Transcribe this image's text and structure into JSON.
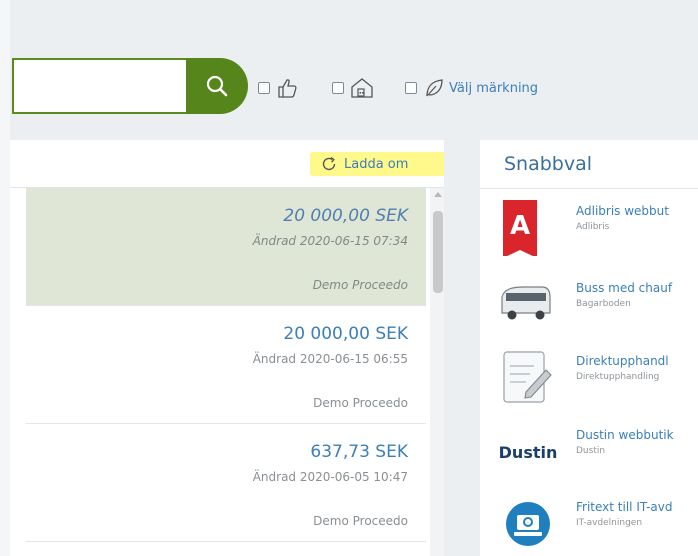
{
  "search": {
    "value": "",
    "placeholder": ""
  },
  "filters": {
    "marking_label": "Välj märkning"
  },
  "toolbar": {
    "reload_label": "Ladda om"
  },
  "list": {
    "items": [
      {
        "amount": "20 000,00 SEK",
        "modified": "Ändrad 2020-06-15 07:34",
        "owner": "Demo Proceedo",
        "selected": true
      },
      {
        "amount": "20 000,00 SEK",
        "modified": "Ändrad 2020-06-15 06:55",
        "owner": "Demo Proceedo",
        "selected": false
      },
      {
        "amount": "637,73 SEK",
        "modified": "Ändrad 2020-06-05 10:47",
        "owner": "Demo Proceedo",
        "selected": false
      }
    ]
  },
  "quick": {
    "title": "Snabbval",
    "links": [
      {
        "name": "Adlibris webbut",
        "sub": "Adlibris",
        "icon": "adlibris-logo"
      },
      {
        "name": "Buss med chauf",
        "sub": "Bagarboden",
        "icon": "bus-icon"
      },
      {
        "name": "Direktupphandl",
        "sub": "Direktupphandling",
        "icon": "document-edit-icon"
      },
      {
        "name": "Dustin webbutik",
        "sub": "Dustin",
        "logo_text": "Dustin",
        "icon": "dustin-logo"
      },
      {
        "name": "Fritext till IT-avd",
        "sub": "IT-avdelningen",
        "icon": "it-support-icon"
      }
    ]
  },
  "colors": {
    "accent_green": "#55851b",
    "link_blue": "#3a7fb8",
    "highlight": "#fff88a",
    "selected_row": "#dfe6d6"
  }
}
